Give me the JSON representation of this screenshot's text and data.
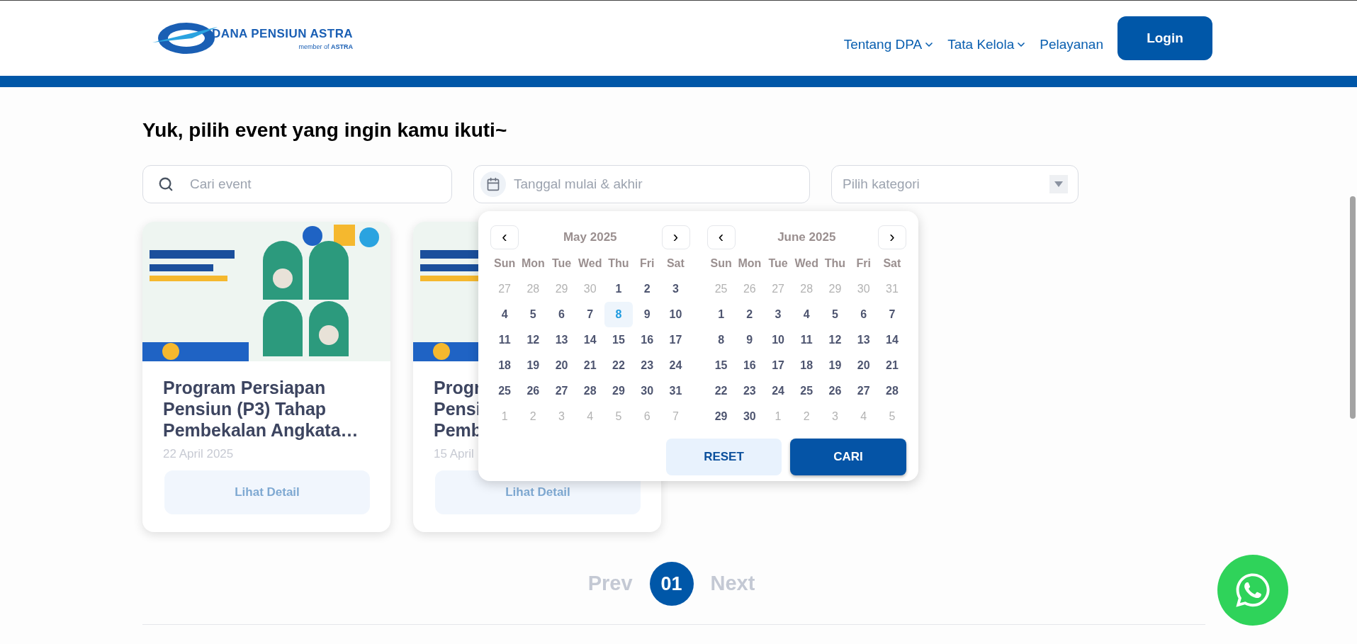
{
  "header": {
    "logo": {
      "name": "DANA PENSIUN ASTRA",
      "tagline": "member of **ASTRA**"
    },
    "nav": [
      {
        "label": "Tentang DPA",
        "dropdown": true
      },
      {
        "label": "Tata Kelola",
        "dropdown": true
      },
      {
        "label": "Pelayanan",
        "dropdown": false
      }
    ],
    "login": "Login"
  },
  "heading": "Yuk, pilih event yang ingin kamu ikuti~",
  "filters": {
    "search": {
      "placeholder": "Cari event"
    },
    "date": {
      "placeholder": "Tanggal mulai & akhir"
    },
    "category": {
      "placeholder": "Pilih kategori"
    }
  },
  "cards": [
    {
      "kind": "picture",
      "title_lines": [
        "Program Persiapan",
        "Pensiun (P3) Tahap",
        "Pembekalan Angkata…"
      ],
      "date": "22 April 2025",
      "button": "Lihat Detail"
    },
    {
      "kind": "picture",
      "title_lines": [
        "Progr",
        "Pensi",
        "Pemb"
      ],
      "date": "15 April",
      "button": "Lihat Detail"
    }
  ],
  "calendar": {
    "months": [
      {
        "title": "May 2025",
        "prev": "‹",
        "next": "›",
        "weekdays": [
          "Sun",
          "Mon",
          "Tue",
          "Wed",
          "Thu",
          "Fri",
          "Sat"
        ],
        "weeks": [
          [
            {
              "d": "27",
              "outside": true,
              "selected": false
            },
            {
              "d": "28",
              "outside": true,
              "selected": false
            },
            {
              "d": "29",
              "outside": true,
              "selected": false
            },
            {
              "d": "30",
              "outside": true,
              "selected": false
            },
            {
              "d": "1",
              "outside": false,
              "selected": false
            },
            {
              "d": "2",
              "outside": false,
              "selected": false
            },
            {
              "d": "3",
              "outside": false,
              "selected": false
            }
          ],
          [
            {
              "d": "4",
              "outside": false,
              "selected": false
            },
            {
              "d": "5",
              "outside": false,
              "selected": false
            },
            {
              "d": "6",
              "outside": false,
              "selected": false
            },
            {
              "d": "7",
              "outside": false,
              "selected": false
            },
            {
              "d": "8",
              "outside": false,
              "selected": true
            },
            {
              "d": "9",
              "outside": false,
              "selected": false
            },
            {
              "d": "10",
              "outside": false,
              "selected": false
            }
          ],
          [
            {
              "d": "11",
              "outside": false,
              "selected": false
            },
            {
              "d": "12",
              "outside": false,
              "selected": false
            },
            {
              "d": "13",
              "outside": false,
              "selected": false
            },
            {
              "d": "14",
              "outside": false,
              "selected": false
            },
            {
              "d": "15",
              "outside": false,
              "selected": false
            },
            {
              "d": "16",
              "outside": false,
              "selected": false
            },
            {
              "d": "17",
              "outside": false,
              "selected": false
            }
          ],
          [
            {
              "d": "18",
              "outside": false,
              "selected": false
            },
            {
              "d": "19",
              "outside": false,
              "selected": false
            },
            {
              "d": "20",
              "outside": false,
              "selected": false
            },
            {
              "d": "21",
              "outside": false,
              "selected": false
            },
            {
              "d": "22",
              "outside": false,
              "selected": false
            },
            {
              "d": "23",
              "outside": false,
              "selected": false
            },
            {
              "d": "24",
              "outside": false,
              "selected": false
            }
          ],
          [
            {
              "d": "25",
              "outside": false,
              "selected": false
            },
            {
              "d": "26",
              "outside": false,
              "selected": false
            },
            {
              "d": "27",
              "outside": false,
              "selected": false
            },
            {
              "d": "28",
              "outside": false,
              "selected": false
            },
            {
              "d": "29",
              "outside": false,
              "selected": false
            },
            {
              "d": "30",
              "outside": false,
              "selected": false
            },
            {
              "d": "31",
              "outside": false,
              "selected": false
            }
          ],
          [
            {
              "d": "1",
              "outside": true,
              "selected": false
            },
            {
              "d": "2",
              "outside": true,
              "selected": false
            },
            {
              "d": "3",
              "outside": true,
              "selected": false
            },
            {
              "d": "4",
              "outside": true,
              "selected": false
            },
            {
              "d": "5",
              "outside": true,
              "selected": false
            },
            {
              "d": "6",
              "outside": true,
              "selected": false
            },
            {
              "d": "7",
              "outside": true,
              "selected": false
            }
          ]
        ]
      },
      {
        "title": "June 2025",
        "prev": "‹",
        "next": "›",
        "weekdays": [
          "Sun",
          "Mon",
          "Tue",
          "Wed",
          "Thu",
          "Fri",
          "Sat"
        ],
        "weeks": [
          [
            {
              "d": "25",
              "outside": true,
              "selected": false
            },
            {
              "d": "26",
              "outside": true,
              "selected": false
            },
            {
              "d": "27",
              "outside": true,
              "selected": false
            },
            {
              "d": "28",
              "outside": true,
              "selected": false
            },
            {
              "d": "29",
              "outside": true,
              "selected": false
            },
            {
              "d": "30",
              "outside": true,
              "selected": false
            },
            {
              "d": "31",
              "outside": true,
              "selected": false
            }
          ],
          [
            {
              "d": "1",
              "outside": false,
              "selected": false
            },
            {
              "d": "2",
              "outside": false,
              "selected": false
            },
            {
              "d": "3",
              "outside": false,
              "selected": false
            },
            {
              "d": "4",
              "outside": false,
              "selected": false
            },
            {
              "d": "5",
              "outside": false,
              "selected": false
            },
            {
              "d": "6",
              "outside": false,
              "selected": false
            },
            {
              "d": "7",
              "outside": false,
              "selected": false
            }
          ],
          [
            {
              "d": "8",
              "outside": false,
              "selected": false
            },
            {
              "d": "9",
              "outside": false,
              "selected": false
            },
            {
              "d": "10",
              "outside": false,
              "selected": false
            },
            {
              "d": "11",
              "outside": false,
              "selected": false
            },
            {
              "d": "12",
              "outside": false,
              "selected": false
            },
            {
              "d": "13",
              "outside": false,
              "selected": false
            },
            {
              "d": "14",
              "outside": false,
              "selected": false
            }
          ],
          [
            {
              "d": "15",
              "outside": false,
              "selected": false
            },
            {
              "d": "16",
              "outside": false,
              "selected": false
            },
            {
              "d": "17",
              "outside": false,
              "selected": false
            },
            {
              "d": "18",
              "outside": false,
              "selected": false
            },
            {
              "d": "19",
              "outside": false,
              "selected": false
            },
            {
              "d": "20",
              "outside": false,
              "selected": false
            },
            {
              "d": "21",
              "outside": false,
              "selected": false
            }
          ],
          [
            {
              "d": "22",
              "outside": false,
              "selected": false
            },
            {
              "d": "23",
              "outside": false,
              "selected": false
            },
            {
              "d": "24",
              "outside": false,
              "selected": false
            },
            {
              "d": "25",
              "outside": false,
              "selected": false
            },
            {
              "d": "26",
              "outside": false,
              "selected": false
            },
            {
              "d": "27",
              "outside": false,
              "selected": false
            },
            {
              "d": "28",
              "outside": false,
              "selected": false
            }
          ],
          [
            {
              "d": "29",
              "outside": false,
              "selected": false
            },
            {
              "d": "30",
              "outside": false,
              "selected": false
            },
            {
              "d": "1",
              "outside": true,
              "selected": false
            },
            {
              "d": "2",
              "outside": true,
              "selected": false
            },
            {
              "d": "3",
              "outside": true,
              "selected": false
            },
            {
              "d": "4",
              "outside": true,
              "selected": false
            },
            {
              "d": "5",
              "outside": true,
              "selected": false
            }
          ]
        ]
      }
    ],
    "reset": "RESET",
    "submit": "CARI"
  },
  "pagination": {
    "prev": {
      "label": "Prev",
      "disabled": true
    },
    "pages": [
      {
        "label": "01",
        "selected": true
      }
    ],
    "next": {
      "label": "Next",
      "disabled": true
    }
  }
}
